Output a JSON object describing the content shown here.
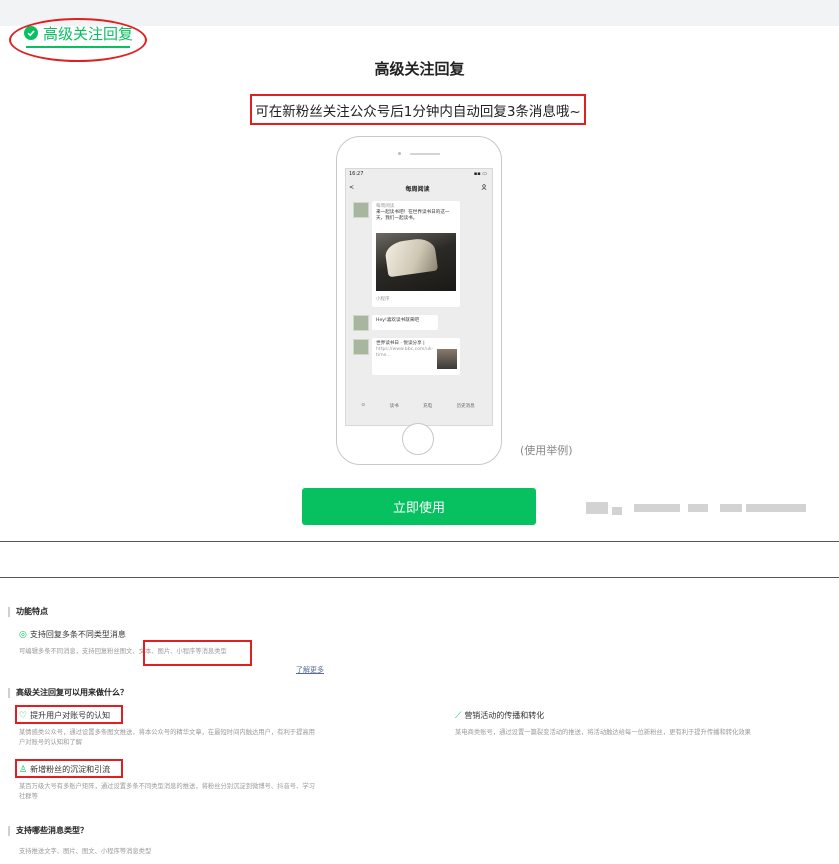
{
  "tab": {
    "label": "高级关注回复"
  },
  "hero": {
    "title": "高级关注回复",
    "subtitle": "可在新粉丝关注公众号后1分钟内自动回复3条消息哦~",
    "example_caption": "(使用举例)",
    "use_button": "立即使用"
  },
  "phone": {
    "time": "16:27",
    "chat_title": "每周阅读",
    "back": "<",
    "msg1_source": "每周阅读",
    "msg1_text": "来一起读书吧！在世界读书日的这一天，我们一起读书。",
    "msg1_footer": "小程序",
    "msg2_text": "Hey!喜欢读书就来吧",
    "msg3_title": "世界读书日 · 悦读分享 |",
    "msg3_url": "https://www.bbc.com/uk-time...",
    "toolbar": [
      "读书",
      "充电",
      "历史消息"
    ]
  },
  "features": {
    "section1_title": "功能特点",
    "feature1_title": "支持回复多条不同类型消息",
    "feature1_desc": "可编辑多条不同消息，支持回复粉丝图文、文本、图片、小程序等消息类型",
    "learn_more": "了解更多",
    "section2_title": "高级关注回复可以用来做什么？",
    "use1_title": "提升用户对账号的认知",
    "use1_desc_line1": "某情感类公众号，通过设置多条图文推送，将本公众号的精华文章，在最短时间内触达用户，有利于提高用",
    "use1_desc_line2": "户对账号的认知和了解",
    "use2_title": "营销活动的传播和转化",
    "use2_desc": "某电商类账号，通过设置一篇裂变活动的推送，将活动触达给每一位新粉丝，更有利于提升传播和转化效果",
    "use3_title": "新增粉丝的沉淀和引流",
    "use3_desc_line1": "某百万级大号有多账户矩阵，通过设置多条不同类型消息的推送，将粉丝分别沉淀到微博号、抖音号、学习",
    "use3_desc_line2": "社群等",
    "section3_title": "支持哪些消息类型？",
    "section3_desc": "支持推送文字、图片、图文、小程序等消息类型"
  },
  "colors": {
    "accent": "#07c160",
    "highlight": "#e02020",
    "link": "#576b95"
  }
}
